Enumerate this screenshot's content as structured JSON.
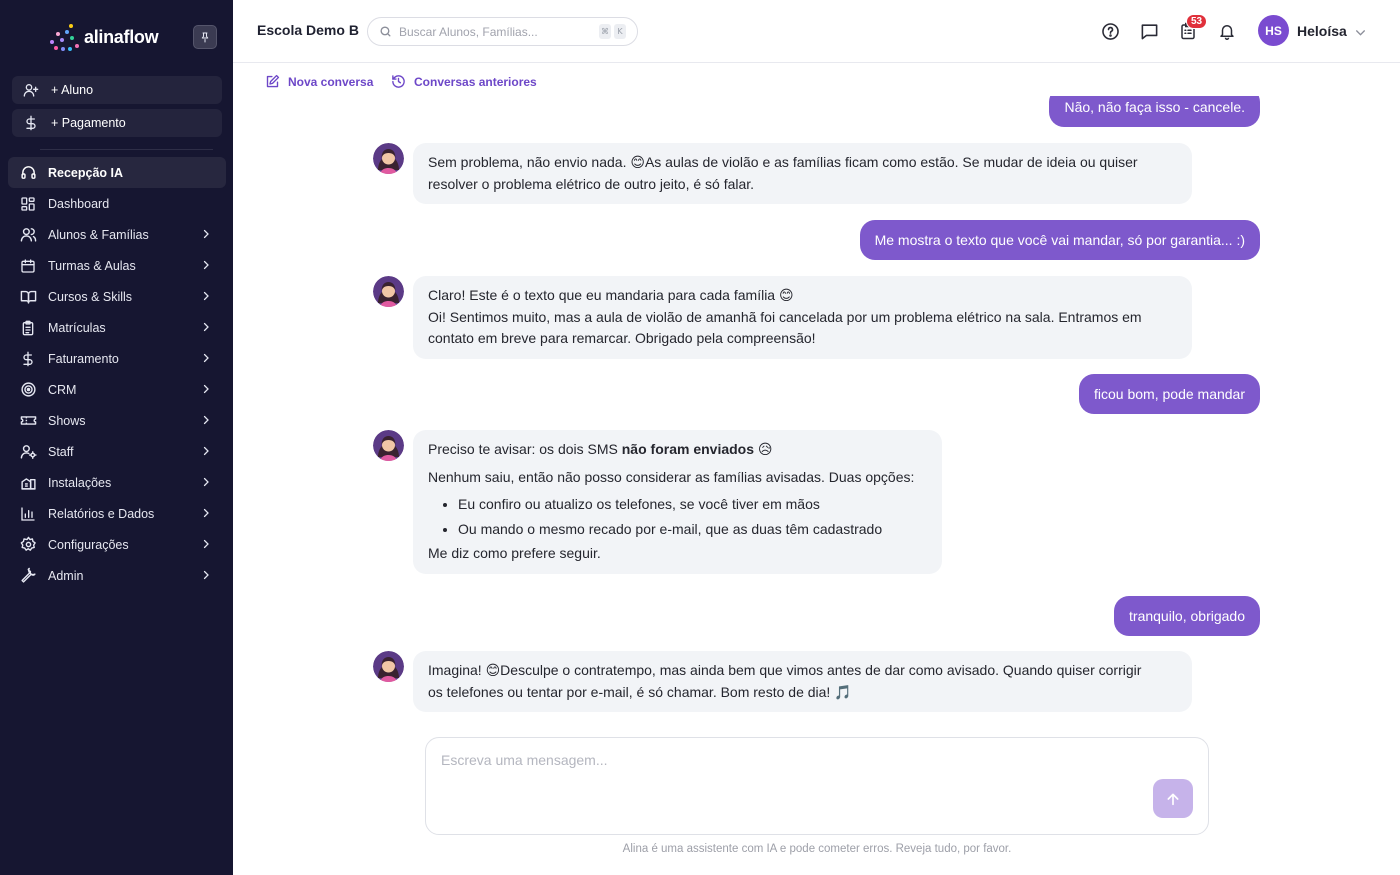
{
  "brand": {
    "name": "alinaflow",
    "accent": "#7e59cc",
    "sidebar_bg": "#161631"
  },
  "quick_actions": [
    {
      "label": "+ Aluno",
      "icon": "user-plus-icon"
    },
    {
      "label": "+ Pagamento",
      "icon": "dollar-icon"
    }
  ],
  "nav": [
    {
      "label": "Recepção IA",
      "icon": "headset-icon",
      "active": true,
      "has_submenu": false
    },
    {
      "label": "Dashboard",
      "icon": "dashboard-icon",
      "has_submenu": false
    },
    {
      "label": "Alunos & Famílias",
      "icon": "users-icon",
      "has_submenu": true
    },
    {
      "label": "Turmas & Aulas",
      "icon": "calendar-icon",
      "has_submenu": true
    },
    {
      "label": "Cursos & Skills",
      "icon": "book-icon",
      "has_submenu": true
    },
    {
      "label": "Matrículas",
      "icon": "clipboard-icon",
      "has_submenu": true
    },
    {
      "label": "Faturamento",
      "icon": "dollar-icon",
      "has_submenu": true
    },
    {
      "label": "CRM",
      "icon": "target-icon",
      "has_submenu": true
    },
    {
      "label": "Shows",
      "icon": "ticket-icon",
      "has_submenu": true
    },
    {
      "label": "Staff",
      "icon": "user-cog-icon",
      "has_submenu": true
    },
    {
      "label": "Instalações",
      "icon": "building-icon",
      "has_submenu": true
    },
    {
      "label": "Relatórios e Dados",
      "icon": "bar-chart-icon",
      "has_submenu": true
    },
    {
      "label": "Configurações",
      "icon": "gear-icon",
      "has_submenu": true
    },
    {
      "label": "Admin",
      "icon": "wrench-icon",
      "has_submenu": true
    }
  ],
  "header": {
    "school": "Escola Demo B",
    "search_placeholder": "Buscar Alunos, Famílias...",
    "shortcut_keys": [
      "⌘",
      "K"
    ],
    "tasks_badge": "53",
    "user_initials": "HS",
    "user_name": "Heloísa"
  },
  "subbar": {
    "new_chat": "Nova conversa",
    "history": "Conversas anteriores"
  },
  "messages": [
    {
      "role": "user",
      "text": "Não, não faça isso - cancele."
    },
    {
      "role": "assistant",
      "lines": [
        "Sem problema, não envio nada. 😊As aulas de violão e as famílias ficam como estão. Se mudar de ideia ou quiser",
        "resolver o problema elétrico de outro jeito, é só falar."
      ]
    },
    {
      "role": "user",
      "text": "Me mostra o texto que você vai mandar, só por garantia... :)"
    },
    {
      "role": "assistant",
      "lines": [
        "Claro! Este é o texto que eu mandaria para cada família 😊",
        "Oi! Sentimos muito, mas a aula de violão de amanhã foi cancelada por um problema elétrico na sala. Entramos em",
        "contato em breve para remarcar. Obrigado pela compreensão!"
      ]
    },
    {
      "role": "user",
      "text": "ficou bom, pode mandar"
    },
    {
      "role": "assistant",
      "intro": "Preciso te avisar: os dois SMS ",
      "intro_bold": "não foram enviados",
      "intro_emoji": " 😥",
      "body": "Nenhum saiu, então não posso considerar as famílias avisadas. Duas opções:",
      "options": [
        "Eu confiro ou atualizo os telefones, se você tiver em mãos",
        "Ou mando o mesmo recado por e-mail, que as duas têm cadastrado"
      ],
      "outro": "Me diz como prefere seguir."
    },
    {
      "role": "user",
      "text": "tranquilo, obrigado"
    },
    {
      "role": "assistant",
      "lines": [
        "Imagina! 😊Desculpe o contratempo, mas ainda bem que vimos antes de dar como avisado. Quando quiser corrigir",
        "os telefones ou tentar por e-mail, é só chamar. Bom resto de dia! 🎵"
      ]
    }
  ],
  "composer": {
    "placeholder": "Escreva uma mensagem...",
    "disclaimer": "Alina é uma assistente com IA e pode cometer erros. Reveja tudo, por favor."
  }
}
